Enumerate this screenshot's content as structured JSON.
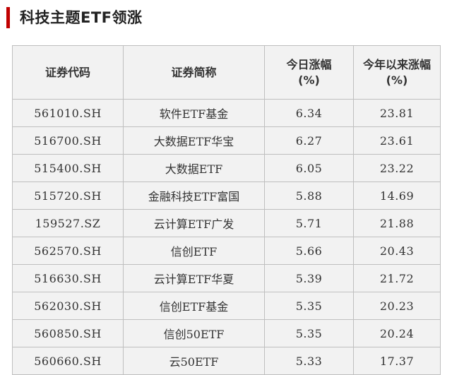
{
  "title": "科技主题ETF领涨",
  "colors": {
    "accent": "#c00000",
    "row_bg": "#f2f2f2",
    "border": "#bfbfbf"
  },
  "table": {
    "headers": {
      "code": "证券代码",
      "name": "证券简称",
      "day_change_line1": "今日涨幅",
      "day_change_line2": "(%)",
      "ytd_change_line1": "今年以来涨幅",
      "ytd_change_line2": "(%)"
    },
    "rows": [
      {
        "code": "561010.SH",
        "name": "软件ETF基金",
        "day": "6.34",
        "ytd": "23.81"
      },
      {
        "code": "516700.SH",
        "name": "大数据ETF华宝",
        "day": "6.27",
        "ytd": "23.61"
      },
      {
        "code": "515400.SH",
        "name": "大数据ETF",
        "day": "6.05",
        "ytd": "23.22"
      },
      {
        "code": "515720.SH",
        "name": "金融科技ETF富国",
        "day": "5.88",
        "ytd": "14.69"
      },
      {
        "code": "159527.SZ",
        "name": "云计算ETF广发",
        "day": "5.71",
        "ytd": "21.88"
      },
      {
        "code": "562570.SH",
        "name": "信创ETF",
        "day": "5.66",
        "ytd": "20.43"
      },
      {
        "code": "516630.SH",
        "name": "云计算ETF华夏",
        "day": "5.39",
        "ytd": "21.72"
      },
      {
        "code": "562030.SH",
        "name": "信创ETF基金",
        "day": "5.35",
        "ytd": "20.23"
      },
      {
        "code": "560850.SH",
        "name": "信创50ETF",
        "day": "5.35",
        "ytd": "20.24"
      },
      {
        "code": "560660.SH",
        "name": "云50ETF",
        "day": "5.33",
        "ytd": "17.37"
      }
    ]
  }
}
